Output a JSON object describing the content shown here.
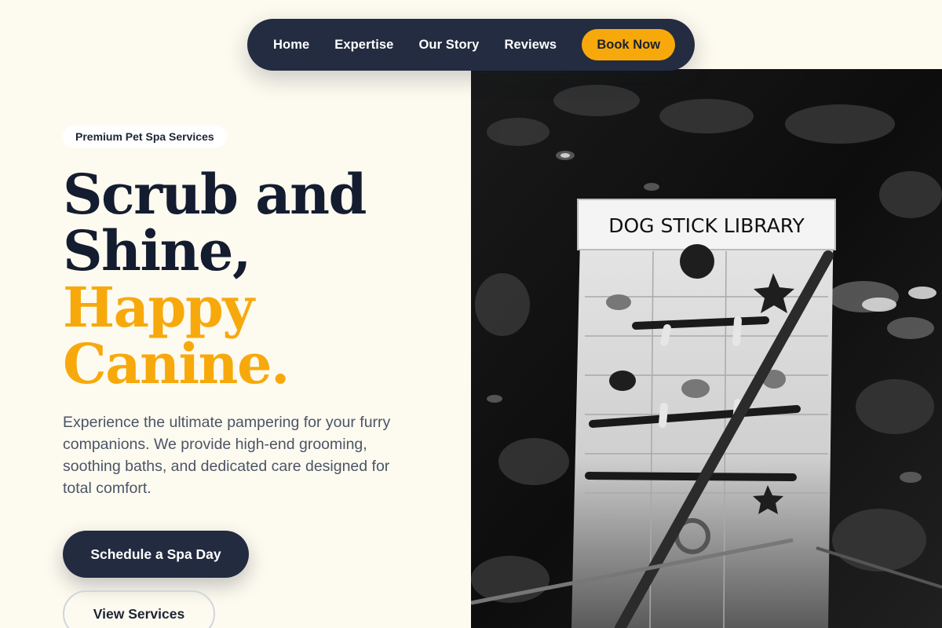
{
  "nav": {
    "links": [
      "Home",
      "Expertise",
      "Our Story",
      "Reviews"
    ],
    "cta": "Book Now"
  },
  "hero": {
    "badge": "Premium Pet Spa Services",
    "headline_dark_1": "Scrub and",
    "headline_dark_2": "Shine,",
    "headline_accent_1": "Happy",
    "headline_accent_2": "Canine.",
    "lead": "Experience the ultimate pampering for your furry companions. We provide high-end grooming, soothing baths, and dedicated care designed for total comfort.",
    "primary_cta": "Schedule a Spa Day",
    "secondary_cta": "View Services"
  },
  "photo": {
    "sign_text": "DOG STICK LIBRARY",
    "style": "black-and-white photograph"
  },
  "colors": {
    "background": "#fdfaef",
    "navy": "#232c40",
    "accent": "#f7a90c",
    "body_text": "#4b5567"
  }
}
